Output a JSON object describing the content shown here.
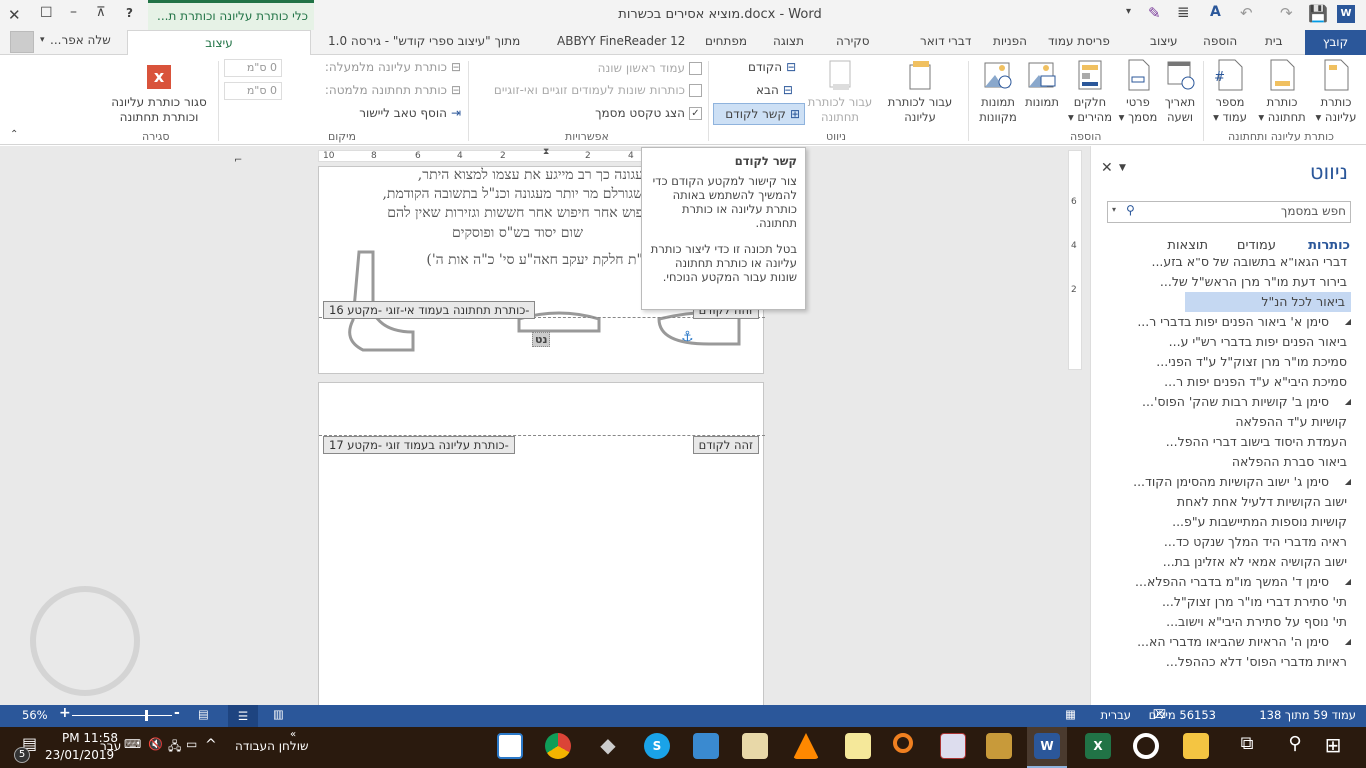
{
  "window": {
    "title": "מוציא אסירים בכשרות.docx - Word",
    "context_tab_group": "כלי כותרת עליונה וכותרת ת...",
    "help": "?",
    "user": "שלה אפר..."
  },
  "tabs": [
    "קובץ",
    "בית",
    "הוספה",
    "עיצוב",
    "פריסת עמוד",
    "הפניות",
    "דברי דואר",
    "סקירה",
    "תצוגה",
    "מפתחים",
    "ABBYY FineReader 12",
    "מתוך \"עיצוב ספרי קודש\" - גירסה 1.0",
    "עיצוב"
  ],
  "ribbon": {
    "groups": {
      "header_footer": {
        "label": "כותרת עליונה ותחתונה",
        "buttons": [
          {
            "l1": "כותרת",
            "l2": "עליונה ▾"
          },
          {
            "l1": "כותרת",
            "l2": "תחתונה ▾"
          },
          {
            "l1": "מספר",
            "l2": "עמוד ▾"
          }
        ]
      },
      "insert": {
        "label": "הוספה",
        "buttons": [
          {
            "l1": "תאריך",
            "l2": "ושעה"
          },
          {
            "l1": "פרטי",
            "l2": "מסמך ▾"
          },
          {
            "l1": "חלקים",
            "l2": "מהירים ▾"
          },
          {
            "l1": "תמונות",
            "l2": ""
          },
          {
            "l1": "תמונות",
            "l2": "מקוונות"
          }
        ]
      },
      "navigation": {
        "label": "ניווט",
        "goto_header_l1": "עבור לכותרת",
        "goto_header_l2": "עליונה",
        "goto_footer_l1": "עבור לכותרת",
        "goto_footer_l2": "תחתונה",
        "previous": "הקודם",
        "next": "הבא",
        "link_previous": "קשר לקודם"
      },
      "options": {
        "label": "אפשרויות",
        "different_first": "עמוד ראשון שונה",
        "different_odd_even": "כותרות שונות לעמודים זוגיים ואי-זוגיים",
        "show_doc_text": "הצג טקסט מסמך",
        "checked_mark": "✓"
      },
      "position": {
        "label": "מיקום",
        "header_from_top": "כותרת עליונה מלמעלה:",
        "header_value": "0 ס\"מ",
        "footer_from_bottom": "כותרת תחתונה מלמטה:",
        "footer_value": "0 ס\"מ",
        "insert_tab": "הוסף טאב ליישור"
      },
      "close": {
        "label": "סגירה",
        "l1": "סגור כותרת עליונה",
        "l2": "וכותרת תחתונה"
      }
    }
  },
  "ruler": [
    "10",
    "8",
    "6",
    "4",
    "2",
    "2",
    "4"
  ],
  "vruler": [
    "6",
    "4",
    "2"
  ],
  "document": {
    "lines": [
      "עגונה כך רב מייגע את עצמו למצוא היתר,",
      "שגורלם מר יותר מעגונה וכנ\"ל בתשובה הקודמת,",
      "פוש אחר חיפוש אחר חששות וגזירות שאין להם",
      "שום יסוד בש\"ס ופוסקים",
      "\"ת חלקת יעקב חאה\"ע סי' כ\"ה אות ה')"
    ],
    "footer_tag_16": "-כותרת תחתונה בעמוד אי-זוגי -מקטע 16",
    "same_prev_16": "זהה לקודם",
    "header_tag_17": "-כותרת עליונה בעמוד זוגי -מקטע 17",
    "same_prev_17": "זהה לקודם",
    "page_num": "נט"
  },
  "tooltip": {
    "title": "קשר לקודם",
    "p1": "צור קישור למקטע הקודם כדי להמשיך להשתמש באותה כותרת עליונה או כותרת תחתונה.",
    "p2": "בטל תכונה זו כדי ליצור כותרת עליונה או כותרת תחתונה שונות עבור המקטע הנוכחי."
  },
  "nav": {
    "title": "ניווט",
    "search_placeholder": "חפש במסמך",
    "tabs": [
      "כותרות",
      "עמודים",
      "תוצאות"
    ],
    "items": [
      {
        "t": "דברי הגאו\"א בתשובה של ס\"א בזע...",
        "e": false
      },
      {
        "t": "בירור דעת מו\"ר מרן הראש\"ל של...",
        "e": false
      },
      {
        "t": "ביאור לכל הנ\"ל",
        "e": false,
        "sel": true
      },
      {
        "t": "סימן א' ביאור הפנים יפות בדברי ר...",
        "e": true
      },
      {
        "t": "ביאור הפנים יפות בדברי רש\"י ע...",
        "e": false
      },
      {
        "t": "סמיכת מו\"ר מרן זצוק\"ל ע\"ד הפני...",
        "e": false
      },
      {
        "t": "סמיכת היבי\"א ע\"ד הפנים יפות ר...",
        "e": false
      },
      {
        "t": "סימן ב' קושיות רבות שהק' הפוס'...",
        "e": true
      },
      {
        "t": "קושיות ע\"ד ההפלאה",
        "e": false
      },
      {
        "t": "העמדת היסוד בישוב דברי ההפל...",
        "e": false
      },
      {
        "t": "ביאור סברת ההפלאה",
        "e": false
      },
      {
        "t": "סימן ג' ישוב הקושיות מהסימן הקוד...",
        "e": true
      },
      {
        "t": "ישוב הקושיות דלעיל אחת לאחת",
        "e": false
      },
      {
        "t": "קושיות נוספות המתיישבות ע\"פ...",
        "e": false
      },
      {
        "t": "ראיה מדברי היד המלך שנקט כד...",
        "e": false
      },
      {
        "t": "ישוב הקושיה אמאי לא אזלינן בת...",
        "e": false
      },
      {
        "t": "סימן ד' המשך מו\"מ בדברי ההפלא...",
        "e": true
      },
      {
        "t": "תי' סתירת דברי מו\"ר מרן זצוק\"ל...",
        "e": false
      },
      {
        "t": "תי' נוסף על סתירת היבי\"א וישוב...",
        "e": false
      },
      {
        "t": "סימן ה' הראיות שהביאו מדברי הא...",
        "e": true
      },
      {
        "t": "ראיות מדברי הפוס' דלא כההפל...",
        "e": false
      }
    ]
  },
  "status": {
    "page": "עמוד 59 מתוך 138",
    "words": "56153 מילים",
    "language": "עברית",
    "zoom": "56%",
    "zoom_level_percent": 56
  },
  "taskbar": {
    "time": "PM 11:58",
    "date": "23/01/2019",
    "lang": "עבר",
    "desktop": "שולחן העבודה",
    "notifications": "5"
  },
  "colors": {
    "accent": "#2b579a",
    "context": "#217346",
    "taskbar": "#2a1a0e"
  }
}
